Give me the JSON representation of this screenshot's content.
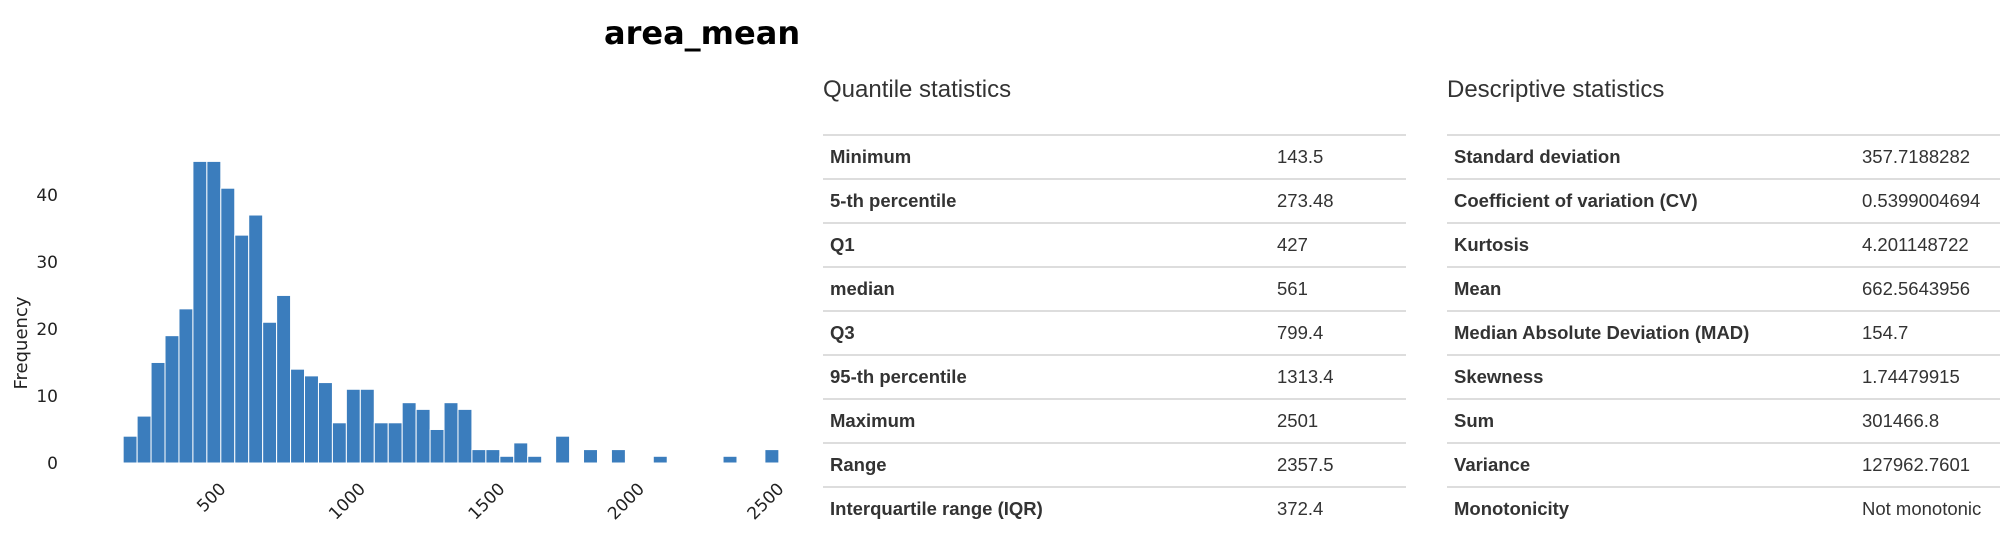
{
  "chart_data": {
    "type": "bar",
    "title": "area_mean",
    "ylabel": "Frequency",
    "xlabel": "",
    "x_ticks": [
      500,
      1000,
      1500,
      2000,
      2500
    ],
    "y_ticks": [
      0,
      10,
      20,
      30,
      40
    ],
    "xlim": [
      110,
      2540
    ],
    "ylim": [
      0,
      47
    ],
    "bin_width": 50,
    "bins": [
      {
        "start": 150,
        "count": 4
      },
      {
        "start": 200,
        "count": 7
      },
      {
        "start": 250,
        "count": 15
      },
      {
        "start": 300,
        "count": 19
      },
      {
        "start": 350,
        "count": 23
      },
      {
        "start": 400,
        "count": 45
      },
      {
        "start": 450,
        "count": 45
      },
      {
        "start": 500,
        "count": 41
      },
      {
        "start": 550,
        "count": 34
      },
      {
        "start": 600,
        "count": 37
      },
      {
        "start": 650,
        "count": 21
      },
      {
        "start": 700,
        "count": 25
      },
      {
        "start": 750,
        "count": 14
      },
      {
        "start": 800,
        "count": 13
      },
      {
        "start": 850,
        "count": 12
      },
      {
        "start": 900,
        "count": 6
      },
      {
        "start": 950,
        "count": 11
      },
      {
        "start": 1000,
        "count": 11
      },
      {
        "start": 1050,
        "count": 6
      },
      {
        "start": 1100,
        "count": 6
      },
      {
        "start": 1150,
        "count": 9
      },
      {
        "start": 1200,
        "count": 8
      },
      {
        "start": 1250,
        "count": 5
      },
      {
        "start": 1300,
        "count": 9
      },
      {
        "start": 1350,
        "count": 8
      },
      {
        "start": 1400,
        "count": 2
      },
      {
        "start": 1450,
        "count": 2
      },
      {
        "start": 1500,
        "count": 1
      },
      {
        "start": 1550,
        "count": 3
      },
      {
        "start": 1600,
        "count": 1
      },
      {
        "start": 1700,
        "count": 4
      },
      {
        "start": 1800,
        "count": 2
      },
      {
        "start": 1900,
        "count": 2
      },
      {
        "start": 2050,
        "count": 1
      },
      {
        "start": 2300,
        "count": 1
      },
      {
        "start": 2450,
        "count": 2
      }
    ],
    "bar_color": "#3b7dbd",
    "grid": false
  },
  "quantile": {
    "title": "Quantile statistics",
    "rows": [
      {
        "label": "Minimum",
        "value": "143.5"
      },
      {
        "label": "5-th percentile",
        "value": "273.48"
      },
      {
        "label": "Q1",
        "value": "427"
      },
      {
        "label": "median",
        "value": "561"
      },
      {
        "label": "Q3",
        "value": "799.4"
      },
      {
        "label": "95-th percentile",
        "value": "1313.4"
      },
      {
        "label": "Maximum",
        "value": "2501"
      },
      {
        "label": "Range",
        "value": "2357.5"
      },
      {
        "label": "Interquartile range (IQR)",
        "value": "372.4"
      }
    ]
  },
  "descriptive": {
    "title": "Descriptive statistics",
    "rows": [
      {
        "label": "Standard deviation",
        "value": "357.7188282"
      },
      {
        "label": "Coefficient of variation (CV)",
        "value": "0.5399004694"
      },
      {
        "label": "Kurtosis",
        "value": "4.201148722"
      },
      {
        "label": "Mean",
        "value": "662.5643956"
      },
      {
        "label": "Median Absolute Deviation (MAD)",
        "value": "154.7"
      },
      {
        "label": "Skewness",
        "value": "1.74479915"
      },
      {
        "label": "Sum",
        "value": "301466.8"
      },
      {
        "label": "Variance",
        "value": "127962.7601"
      },
      {
        "label": "Monotonicity",
        "value": "Not monotonic"
      }
    ]
  }
}
